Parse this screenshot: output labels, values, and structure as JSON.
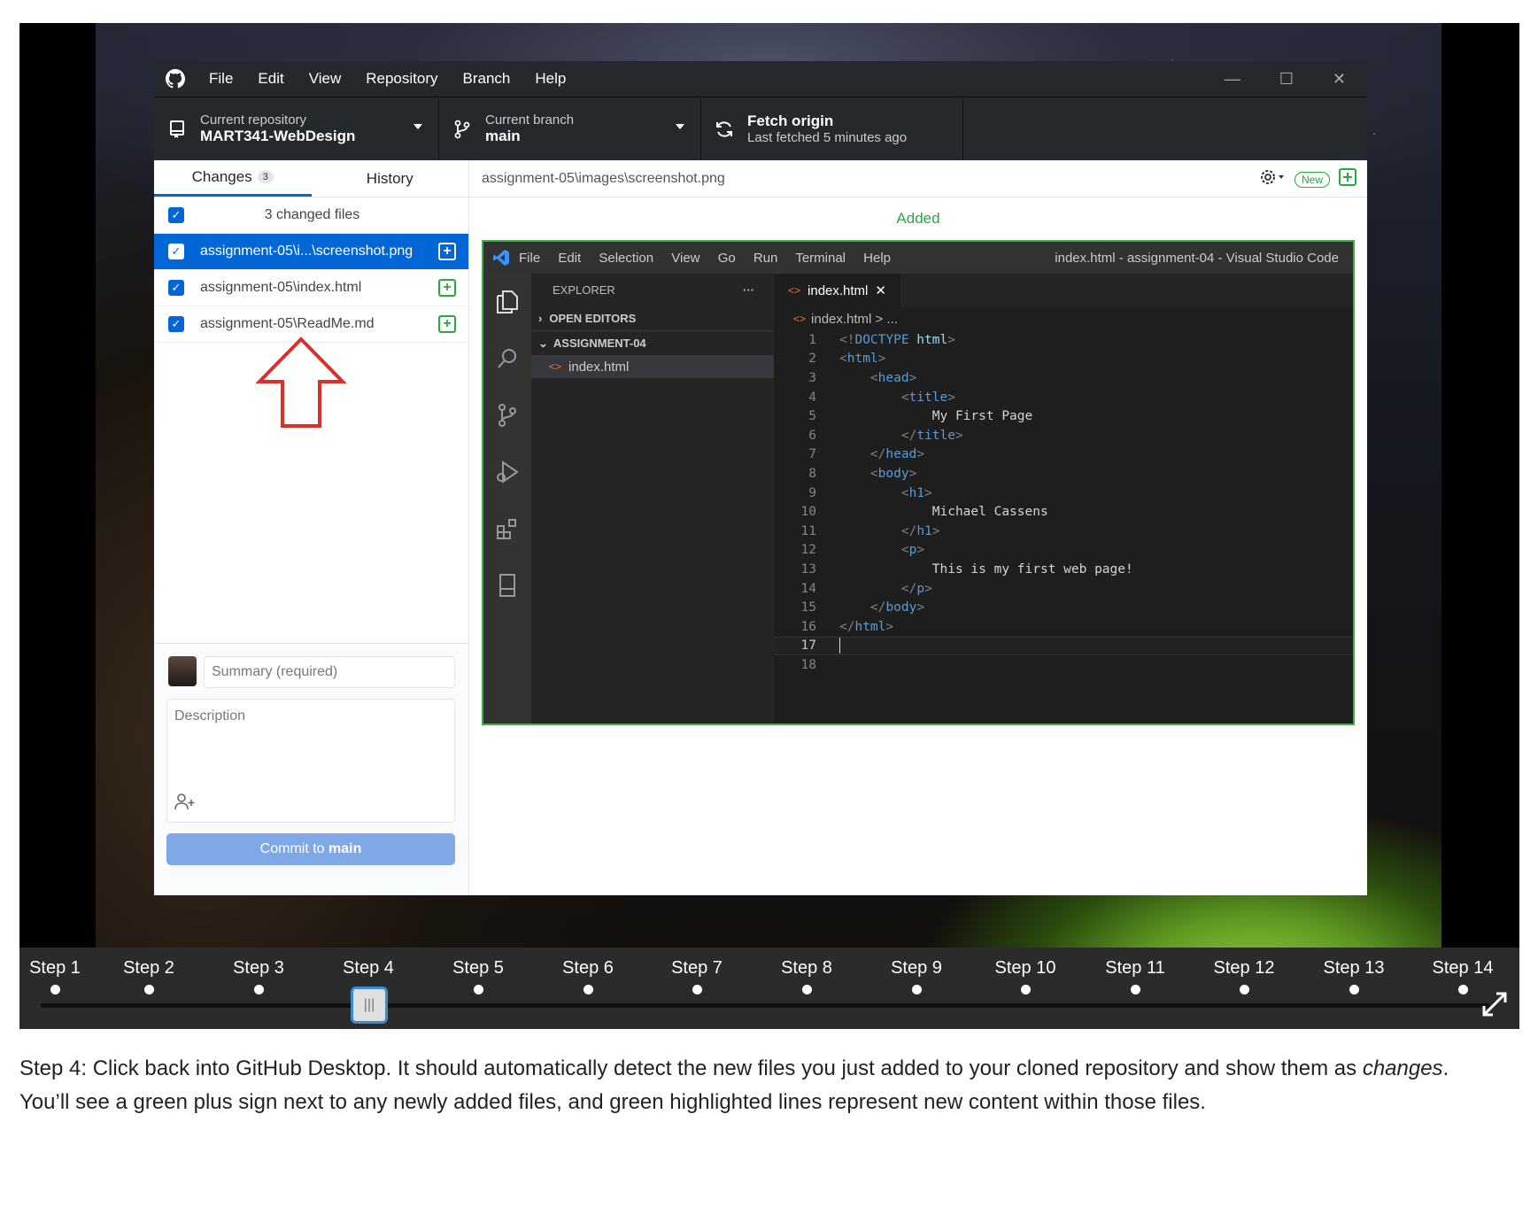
{
  "window": {
    "menu": [
      "File",
      "Edit",
      "View",
      "Repository",
      "Branch",
      "Help"
    ],
    "repo_label": "Current repository",
    "repo_name": "MART341-WebDesign",
    "branch_label": "Current branch",
    "branch_name": "main",
    "fetch_title": "Fetch origin",
    "fetch_sub": "Last fetched 5 minutes ago"
  },
  "left": {
    "tab_changes": "Changes",
    "changes_count": "3",
    "tab_history": "History",
    "changed_files": "3 changed files",
    "files": [
      "assignment-05\\i...\\screenshot.png",
      "assignment-05\\index.html",
      "assignment-05\\ReadMe.md"
    ],
    "summary_placeholder": "Summary (required)",
    "description_placeholder": "Description",
    "commit_prefix": "Commit to ",
    "commit_branch": "main"
  },
  "right": {
    "path": "assignment-05\\images\\screenshot.png",
    "new_label": "New",
    "added_label": "Added"
  },
  "vscode": {
    "menu": [
      "File",
      "Edit",
      "Selection",
      "View",
      "Go",
      "Run",
      "Terminal",
      "Help"
    ],
    "window_title": "index.html - assignment-04 - Visual Studio Code",
    "explorer": "EXPLORER",
    "explorer_more": "···",
    "open_editors": "OPEN EDITORS",
    "folder": "ASSIGNMENT-04",
    "file": "index.html",
    "tab": "index.html",
    "breadcrumb": "index.html > ...",
    "lines": [
      {
        "n": "1",
        "t": "<!DOCTYPE html>"
      },
      {
        "n": "2",
        "t": "<html>"
      },
      {
        "n": "3",
        "t": "    <head>"
      },
      {
        "n": "4",
        "t": "        <title>"
      },
      {
        "n": "5",
        "t": "            My First Page"
      },
      {
        "n": "6",
        "t": "        </title>"
      },
      {
        "n": "7",
        "t": "    </head>"
      },
      {
        "n": "8",
        "t": "    <body>"
      },
      {
        "n": "9",
        "t": "        <h1>"
      },
      {
        "n": "10",
        "t": "            Michael Cassens"
      },
      {
        "n": "11",
        "t": "        </h1>"
      },
      {
        "n": "12",
        "t": "        <p>"
      },
      {
        "n": "13",
        "t": "            This is my first web page!"
      },
      {
        "n": "14",
        "t": "        </p>"
      },
      {
        "n": "15",
        "t": "    </body>"
      },
      {
        "n": "16",
        "t": "</html>"
      },
      {
        "n": "17",
        "t": ""
      },
      {
        "n": "18",
        "t": ""
      }
    ]
  },
  "steps": [
    "Step 1",
    "Step 2",
    "Step 3",
    "Step 4",
    "Step 5",
    "Step 6",
    "Step 7",
    "Step 8",
    "Step 9",
    "Step 10",
    "Step 11",
    "Step 12",
    "Step 13",
    "Step 14"
  ],
  "current_step": 4,
  "caption": {
    "part1": "Step 4: Click back into GitHub Desktop. It should automatically detect the new files you just added to your cloned repository and show them as ",
    "em": "changes",
    "part2": ". You’ll see a green plus sign next to any newly added files, and green highlighted lines represent new content within those files."
  }
}
